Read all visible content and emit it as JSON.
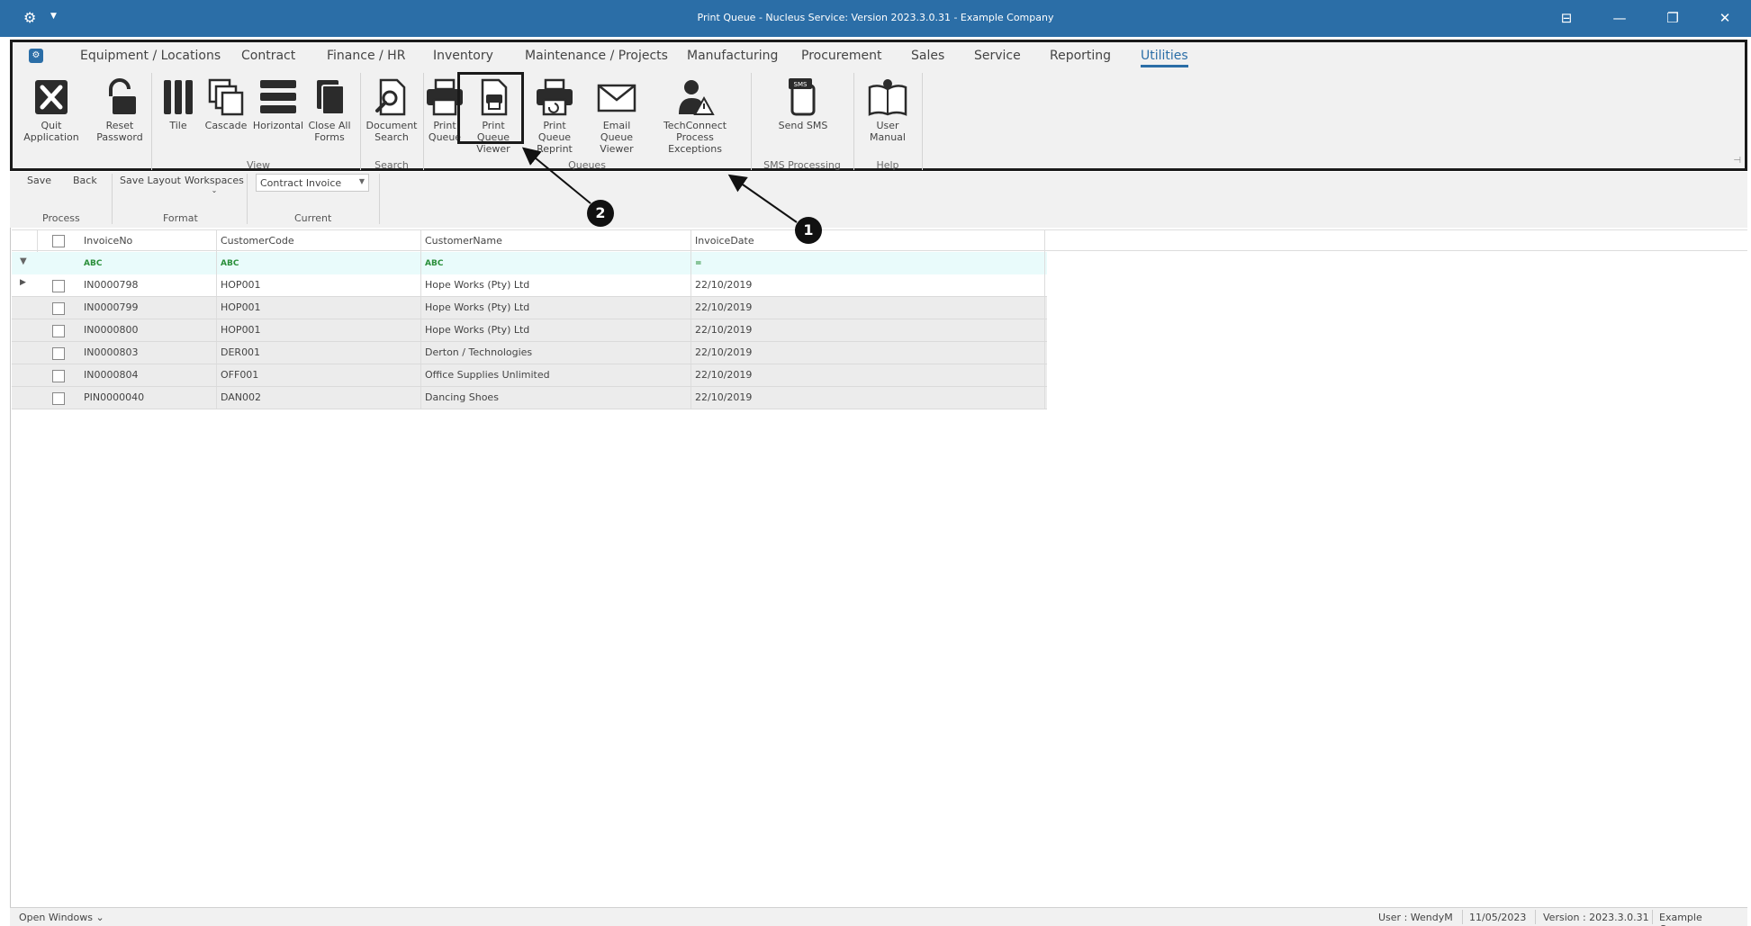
{
  "window": {
    "title": "Print Queue - Nucleus Service: Version 2023.3.0.31 - Example Company"
  },
  "ribbon": {
    "tabs": [
      "Equipment / Locations",
      "Contract",
      "Finance / HR",
      "Inventory",
      "Maintenance / Projects",
      "Manufacturing",
      "Procurement",
      "Sales",
      "Service",
      "Reporting",
      "Utilities"
    ],
    "active_tab": "Utilities",
    "buttons": {
      "quit": "Quit Application",
      "reset_1": "Reset",
      "reset_2": "Password",
      "tile": "Tile",
      "cascade": "Cascade",
      "horizontal": "Horizontal",
      "close_all_1": "Close All",
      "close_all_2": "Forms",
      "doc_search_1": "Document",
      "doc_search_2": "Search",
      "print_queue_1": "Print",
      "print_queue_2": "Queue",
      "pq_viewer_1": "Print Queue",
      "pq_viewer_2": "Viewer",
      "pq_reprint_1": "Print Queue",
      "pq_reprint_2": "Reprint",
      "email_queue_1": "Email Queue",
      "email_queue_2": "Viewer",
      "techconnect_1": "TechConnect",
      "techconnect_2": "Process Exceptions",
      "send_sms": "Send SMS",
      "user_manual": "User Manual"
    },
    "groups": {
      "view": "View",
      "search": "Search",
      "queues": "Queues",
      "sms": "SMS Processing",
      "help": "Help"
    }
  },
  "toolbar2": {
    "save": "Save",
    "back": "Back",
    "save_layout": "Save Layout",
    "workspaces": "Workspaces",
    "combo_value": "Contract Invoice",
    "group_process": "Process",
    "group_format": "Format",
    "group_current": "Current"
  },
  "grid": {
    "columns": [
      "InvoiceNo",
      "CustomerCode",
      "CustomerName",
      "InvoiceDate"
    ],
    "filter_symbols": [
      "ABC",
      "ABC",
      "ABC",
      "="
    ],
    "rows": [
      [
        "IN0000798",
        "HOP001",
        "Hope Works (Pty) Ltd",
        "22/10/2019"
      ],
      [
        "IN0000799",
        "HOP001",
        "Hope Works (Pty) Ltd",
        "22/10/2019"
      ],
      [
        "IN0000800",
        "HOP001",
        "Hope Works (Pty) Ltd",
        "22/10/2019"
      ],
      [
        "IN0000803",
        "DER001",
        "Derton / Technologies",
        "22/10/2019"
      ],
      [
        "IN0000804",
        "OFF001",
        "Office Supplies Unlimited",
        "22/10/2019"
      ],
      [
        "PIN0000040",
        "DAN002",
        "Dancing Shoes",
        "22/10/2019"
      ]
    ]
  },
  "callouts": {
    "one": "1",
    "two": "2"
  },
  "status": {
    "open_windows": "Open Windows",
    "user": "User : WendyM",
    "date": "11/05/2023",
    "version": "Version : 2023.3.0.31",
    "company": "Example Company"
  },
  "colors": {
    "titlebar": "#2b6ea7",
    "filter_row": "#e9fbfb",
    "row_alt": "#ececec"
  }
}
